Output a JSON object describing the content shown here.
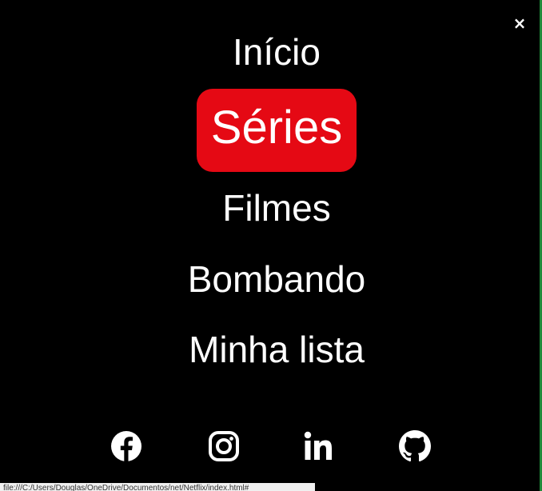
{
  "close_label": "×",
  "menu": {
    "items": [
      {
        "label": "Início",
        "active": false
      },
      {
        "label": "Séries",
        "active": true
      },
      {
        "label": "Filmes",
        "active": false
      },
      {
        "label": "Bombando",
        "active": false
      },
      {
        "label": "Minha lista",
        "active": false
      }
    ]
  },
  "social": [
    {
      "icon": "facebook-icon"
    },
    {
      "icon": "instagram-icon"
    },
    {
      "icon": "linkedin-icon"
    },
    {
      "icon": "github-icon"
    }
  ],
  "status_bar_url": "file:///C:/Users/Douglas/OneDrive/Documentos/net/Netflix/index.html#",
  "colors": {
    "background": "#000000",
    "text": "#ffffff",
    "accent": "#e50914"
  }
}
